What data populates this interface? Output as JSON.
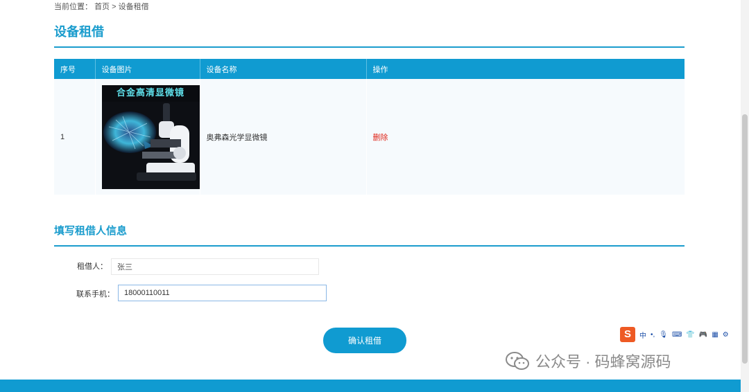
{
  "breadcrumb": {
    "prefix": "当前位置：",
    "home": "首页",
    "separator": ">",
    "current": "设备租借"
  },
  "page_title": "设备租借",
  "table": {
    "headers": [
      "序号",
      "设备图片",
      "设备名称",
      "操作"
    ],
    "rows": [
      {
        "index": "1",
        "image_caption": "合金高清显微镜",
        "name": "奥弗森光学显微镜",
        "action": "删除"
      }
    ]
  },
  "renter_section": {
    "title": "填写租借人信息",
    "name_label": "租借人：",
    "name_value": "张三",
    "phone_label": "联系手机：",
    "phone_value": "18000110011"
  },
  "confirm_button": "确认租借",
  "ime_toolbar": {
    "logo": "S",
    "mode": "中"
  },
  "watermark": "公众号 · 码蜂窝源码",
  "colors": {
    "accent": "#109bd1",
    "title": "#1a9ccd",
    "delete": "#e0281c"
  }
}
